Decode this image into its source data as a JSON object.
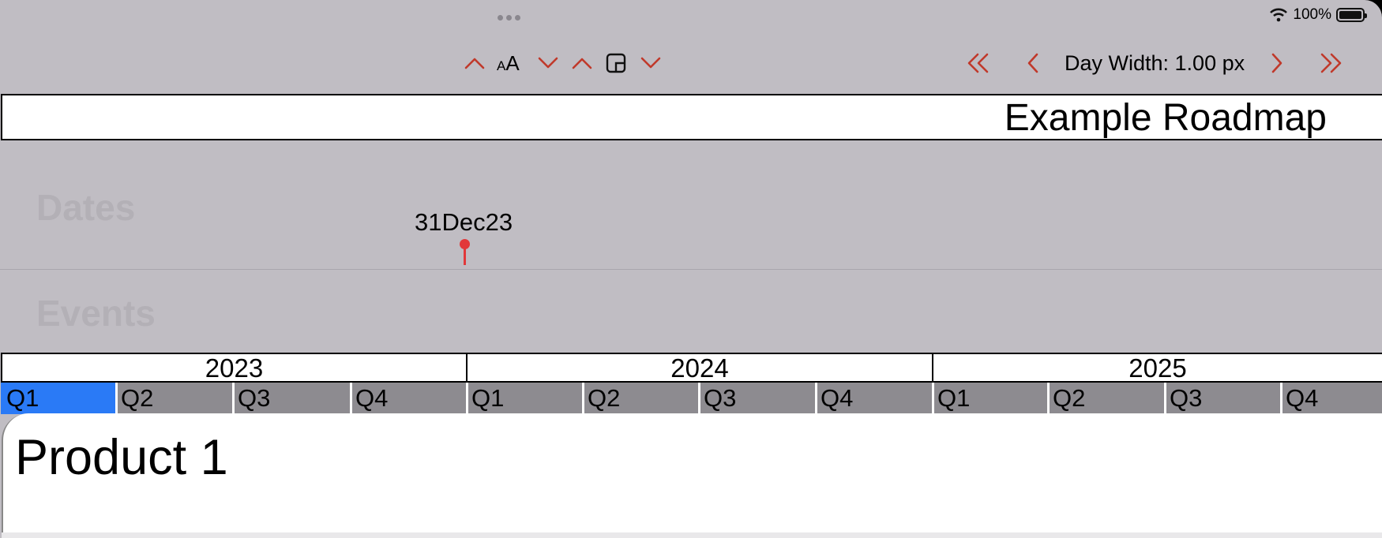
{
  "status_bar": {
    "battery": "100%"
  },
  "toolbar": {
    "font_size_small": "A",
    "font_size_large": "A",
    "day_width": "Day Width: 1.00 px"
  },
  "roadmap": {
    "title": "Example Roadmap"
  },
  "lanes": {
    "dates_label": "Dates",
    "events_label": "Events",
    "date_marker": "31Dec23"
  },
  "timeline": {
    "years": [
      "2023",
      "2024",
      "2025"
    ],
    "quarters": [
      "Q1",
      "Q2",
      "Q3",
      "Q4",
      "Q1",
      "Q2",
      "Q3",
      "Q4",
      "Q1",
      "Q2",
      "Q3",
      "Q4"
    ],
    "selected_quarter": "Q1 2023"
  },
  "product": {
    "title": "Product 1"
  },
  "colors": {
    "accent": "#c0392b",
    "selection": "#2a7af6",
    "marker": "#e2383a"
  },
  "icons": [
    "wifi-icon",
    "battery-icon",
    "chevron-up-icon",
    "chevron-down-icon",
    "layout-icon",
    "double-chevron-left-icon",
    "chevron-left-icon",
    "chevron-right-icon",
    "double-chevron-right-icon",
    "pin-icon"
  ]
}
